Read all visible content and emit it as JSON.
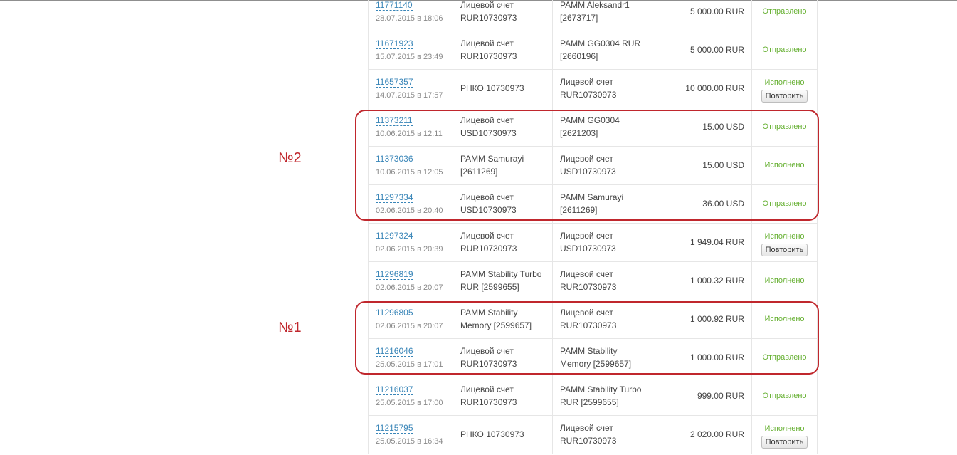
{
  "rows": [
    {
      "id": "11771140",
      "date": "28.07.2015 в 18:06",
      "from": [
        "Лицевой счет",
        "RUR10730973"
      ],
      "to": [
        "PAMM Aleksandr1",
        "[2673717]"
      ],
      "amount": "5 000.00 RUR",
      "status": "Отправлено",
      "repeat": ""
    },
    {
      "id": "11671923",
      "date": "15.07.2015 в 23:49",
      "from": [
        "Лицевой счет",
        "RUR10730973"
      ],
      "to": [
        "PAMM GG0304 RUR",
        "[2660196]"
      ],
      "amount": "5 000.00 RUR",
      "status": "Отправлено",
      "repeat": ""
    },
    {
      "id": "11657357",
      "date": "14.07.2015 в 17:57",
      "from": [
        "РНКО 10730973",
        ""
      ],
      "to": [
        "Лицевой счет",
        "RUR10730973"
      ],
      "amount": "10 000.00 RUR",
      "status": "Исполнено",
      "repeat": "Повторить"
    },
    {
      "id": "11373211",
      "date": "10.06.2015 в 12:11",
      "from": [
        "Лицевой счет",
        "USD10730973"
      ],
      "to": [
        "PAMM GG0304",
        "[2621203]"
      ],
      "amount": "15.00 USD",
      "status": "Отправлено",
      "repeat": ""
    },
    {
      "id": "11373036",
      "date": "10.06.2015 в 12:05",
      "from": [
        "PAMM Samurayi",
        "[2611269]"
      ],
      "to": [
        "Лицевой счет",
        "USD10730973"
      ],
      "amount": "15.00 USD",
      "status": "Исполнено",
      "repeat": ""
    },
    {
      "id": "11297334",
      "date": "02.06.2015 в 20:40",
      "from": [
        "Лицевой счет",
        "USD10730973"
      ],
      "to": [
        "PAMM Samurayi",
        "[2611269]"
      ],
      "amount": "36.00 USD",
      "status": "Отправлено",
      "repeat": ""
    },
    {
      "id": "11297324",
      "date": "02.06.2015 в 20:39",
      "from": [
        "Лицевой счет",
        "RUR10730973"
      ],
      "to": [
        "Лицевой счет",
        "USD10730973"
      ],
      "amount": "1 949.04 RUR",
      "status": "Исполнено",
      "repeat": "Повторить"
    },
    {
      "id": "11296819",
      "date": "02.06.2015 в 20:07",
      "from": [
        "PAMM Stability Turbo",
        "RUR [2599655]"
      ],
      "to": [
        "Лицевой счет",
        "RUR10730973"
      ],
      "amount": "1 000.32 RUR",
      "status": "Исполнено",
      "repeat": ""
    },
    {
      "id": "11296805",
      "date": "02.06.2015 в 20:07",
      "from": [
        "PAMM Stability",
        "Memory [2599657]"
      ],
      "to": [
        "Лицевой счет",
        "RUR10730973"
      ],
      "amount": "1 000.92 RUR",
      "status": "Исполнено",
      "repeat": ""
    },
    {
      "id": "11216046",
      "date": "25.05.2015 в 17:01",
      "from": [
        "Лицевой счет",
        "RUR10730973"
      ],
      "to": [
        "PAMM Stability",
        "Memory [2599657]"
      ],
      "amount": "1 000.00 RUR",
      "status": "Отправлено",
      "repeat": ""
    },
    {
      "id": "11216037",
      "date": "25.05.2015 в 17:00",
      "from": [
        "Лицевой счет",
        "RUR10730973"
      ],
      "to": [
        "PAMM Stability Turbo",
        "RUR [2599655]"
      ],
      "amount": "999.00 RUR",
      "status": "Отправлено",
      "repeat": ""
    },
    {
      "id": "11215795",
      "date": "25.05.2015 в 16:34",
      "from": [
        "РНКО 10730973",
        ""
      ],
      "to": [
        "Лицевой счет",
        "RUR10730973"
      ],
      "amount": "2 020.00 RUR",
      "status": "Исполнено",
      "repeat": "Повторить"
    }
  ],
  "annotations": {
    "label_2": "№2",
    "label_1": "№1",
    "box_color": "#c0272d"
  },
  "colors": {
    "link": "#3a86b8",
    "status": "#66b032",
    "border": "#e6e6e6"
  }
}
